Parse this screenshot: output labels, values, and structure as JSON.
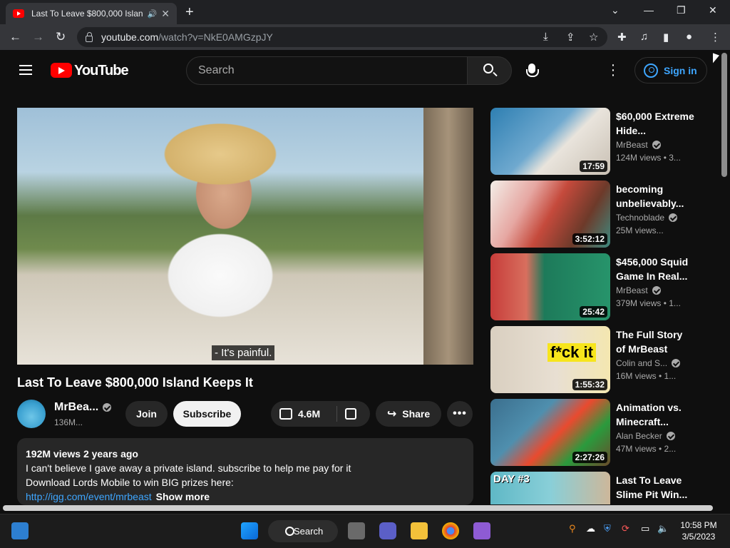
{
  "browser": {
    "tab_title": "Last To Leave $800,000 Islan",
    "new_tab": "+",
    "url_host": "youtube.com",
    "url_path": "/watch?v=NkE0AMGzpJY"
  },
  "youtube": {
    "logo_text": "YouTube",
    "search_placeholder": "Search",
    "sign_in": "Sign in"
  },
  "video": {
    "caption": "- It's painful.",
    "title": "Last To Leave $800,000 Island Keeps It",
    "channel": "MrBea...",
    "subscribers": "136M...",
    "join": "Join",
    "subscribe": "Subscribe",
    "likes": "4.6M",
    "share": "Share",
    "more": "•••",
    "description": {
      "meta": "192M views  2 years ago",
      "line1": "I can't believe I gave away a private island. subscribe to help me pay for it",
      "line2": "Download Lords Mobile to win BIG prizes here:",
      "link": "http://igg.com/event/mrbeast",
      "show_more": "Show more"
    }
  },
  "recommendations": [
    {
      "title": "$60,000 Extreme Hide...",
      "channel": "MrBeast",
      "views": "124M views  • 3...",
      "duration": "17:59",
      "verified": true
    },
    {
      "title": "becoming unbelievably...",
      "channel": "Technoblade",
      "views": "25M views...",
      "duration": "3:52:12",
      "verified": true
    },
    {
      "title": "$456,000 Squid Game In Real...",
      "channel": "MrBeast",
      "views": "379M views  • 1...",
      "duration": "25:42",
      "verified": true
    },
    {
      "title": "The Full Story of MrBeast",
      "channel": "Colin and S...",
      "views": "16M views  • 1...",
      "duration": "1:55:32",
      "verified": true,
      "thumb_text": "f*ck it"
    },
    {
      "title": "Animation vs. Minecraft...",
      "channel": "Alan Becker",
      "views": "47M views  • 2...",
      "duration": "2:27:26",
      "verified": true
    },
    {
      "title": "Last To Leave Slime Pit Win...",
      "thumb_text": "DAY #3"
    }
  ],
  "taskbar": {
    "search_label": "Search",
    "time": "10:58 PM",
    "date": "3/5/2023"
  },
  "colors": {
    "yt_red": "#ff0000",
    "link_blue": "#3ea6ff",
    "bg": "#0f0f0f"
  }
}
